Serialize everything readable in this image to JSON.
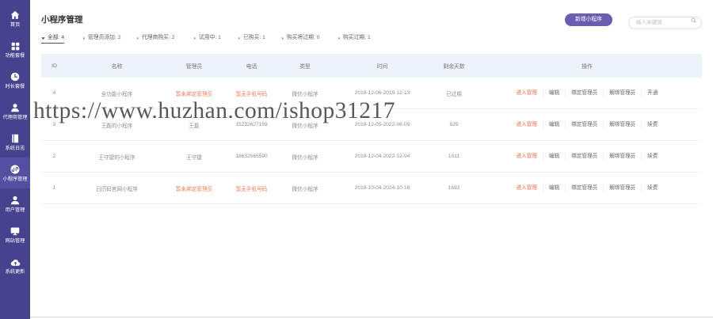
{
  "colors": {
    "sidebar_bg": "#47428e",
    "sidebar_active_bg": "#544fa1",
    "accent": "#6a5db2",
    "warning_text": "#f07c5c",
    "primary_action": "#ea7048",
    "table_header_bg": "#eef2f9"
  },
  "sidebar": {
    "items": [
      {
        "label": "首页",
        "icon": "home-icon",
        "active": false
      },
      {
        "label": "功能套餐",
        "icon": "grid-icon",
        "active": false
      },
      {
        "label": "时长套餐",
        "icon": "clock-icon",
        "active": false
      },
      {
        "label": "代理商管理",
        "icon": "user-icon",
        "active": false
      },
      {
        "label": "系统日志",
        "icon": "book-icon",
        "active": false
      },
      {
        "label": "小程序管理",
        "icon": "mini-program-icon",
        "active": true
      },
      {
        "label": "用户管理",
        "icon": "user-icon",
        "active": false
      },
      {
        "label": "网站管理",
        "icon": "monitor-icon",
        "active": false
      },
      {
        "label": "系统更新",
        "icon": "cloud-upload-icon",
        "active": false
      }
    ]
  },
  "header": {
    "title": "小程序管理",
    "add_button_label": "新增小程序",
    "search_placeholder": "输入关键词",
    "search_icon": "search-icon"
  },
  "filter_icons": {
    "active": "caret-down-icon",
    "inactive": "caret-right-icon"
  },
  "filters": [
    {
      "label": "全部: 4",
      "active": true
    },
    {
      "label": "管理员添加: 2",
      "active": false
    },
    {
      "label": "代理商购买: 2",
      "active": false
    },
    {
      "label": "试用中: 1",
      "active": false
    },
    {
      "label": "已购买: 1",
      "active": false
    },
    {
      "label": "购买将过期: 0",
      "active": false
    },
    {
      "label": "购买过期: 1",
      "active": false
    }
  ],
  "table": {
    "columns": [
      "ID",
      "名称",
      "管理员",
      "电话",
      "类型",
      "时间",
      "剩余天数",
      "操作"
    ],
    "rows": [
      {
        "id": "4",
        "name": "全功能小程序",
        "admin": "暂未绑定管理员",
        "admin_missing": true,
        "phone": "暂无手机号码",
        "phone_missing": true,
        "type": "微信小程序",
        "time": "2019-12-06-2019-12-13",
        "remaining": "已过期",
        "actions": [
          "进入管理",
          "编辑",
          "绑定管理员",
          "解绑管理员",
          "开通"
        ]
      },
      {
        "id": "3",
        "name": "王磊的小程序",
        "admin": "王磊",
        "admin_missing": false,
        "phone": "15232627159",
        "phone_missing": false,
        "type": "微信小程序",
        "time": "2019-12-05-2022-06-05",
        "remaining": "829",
        "actions": [
          "进入管理",
          "编辑",
          "绑定管理员",
          "解绑管理员",
          "续费"
        ]
      },
      {
        "id": "2",
        "name": "王守捷的小程序",
        "admin": "王守捷",
        "admin_missing": false,
        "phone": "18632565590",
        "phone_missing": false,
        "type": "微信小程序",
        "time": "2019-12-04-2022-12-04",
        "remaining": "1011",
        "actions": [
          "进入管理",
          "编辑",
          "绑定管理员",
          "解绑管理员",
          "续费"
        ]
      },
      {
        "id": "1",
        "name": "日历码官网小程序",
        "admin": "暂未绑定管理员",
        "admin_missing": true,
        "phone": "暂无手机号码",
        "phone_missing": true,
        "type": "微信小程序",
        "time": "2019-10-04-2024-10-16",
        "remaining": "1693",
        "actions": [
          "进入管理",
          "编辑",
          "绑定管理员",
          "解绑管理员",
          "续费"
        ]
      }
    ]
  },
  "watermark": "https://www.huzhan.com/ishop31217"
}
